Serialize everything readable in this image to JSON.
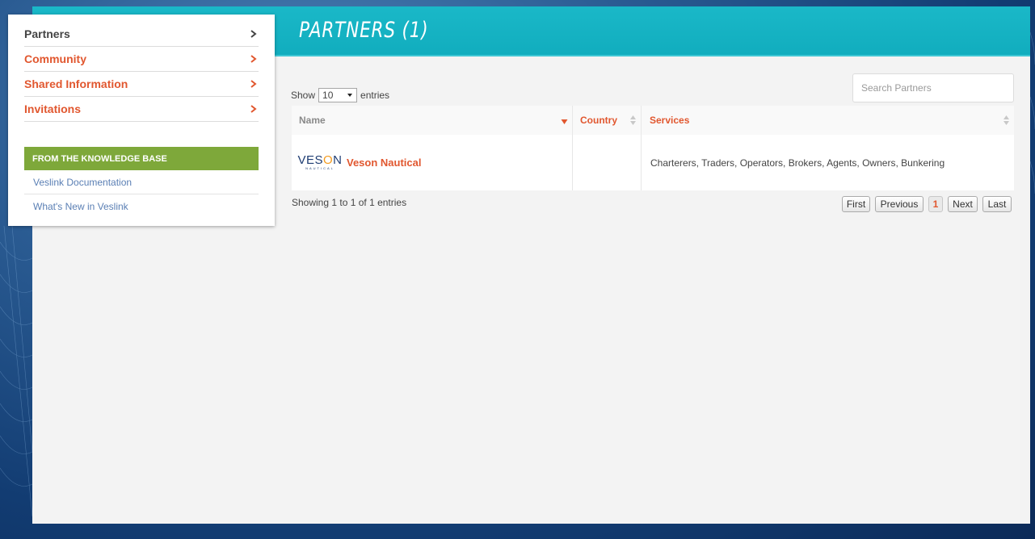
{
  "header": {
    "title": "PARTNERS (1)"
  },
  "sidebar": {
    "items": [
      {
        "label": "Partners",
        "active": true
      },
      {
        "label": "Community",
        "active": false
      },
      {
        "label": "Shared Information",
        "active": false
      },
      {
        "label": "Invitations",
        "active": false
      }
    ],
    "knowledge_base": {
      "title": "FROM THE KNOWLEDGE BASE",
      "links": [
        "Veslink Documentation",
        "What's New in Veslink"
      ]
    }
  },
  "table_controls": {
    "show_label": "Show",
    "entries_label": "entries",
    "page_size": "10",
    "search_placeholder": "Search Partners"
  },
  "table": {
    "columns": [
      "Name",
      "Country",
      "Services"
    ],
    "sorted_column": "Name",
    "rows": [
      {
        "logo": {
          "word_left": "VES",
          "word_o": "O",
          "word_right": "N",
          "sub": "NAUTICAL"
        },
        "name": "Veson Nautical",
        "country": "",
        "services": "Charterers, Traders, Operators, Brokers, Agents, Owners, Bunkering"
      }
    ]
  },
  "pagination": {
    "info": "Showing 1 to 1 of 1 entries",
    "first": "First",
    "previous": "Previous",
    "current": "1",
    "next": "Next",
    "last": "Last"
  },
  "colors": {
    "accent_orange": "#e1572f",
    "header_teal": "#14b2c3",
    "kb_green": "#7ea83a",
    "link_blue": "#5a7fb4"
  }
}
